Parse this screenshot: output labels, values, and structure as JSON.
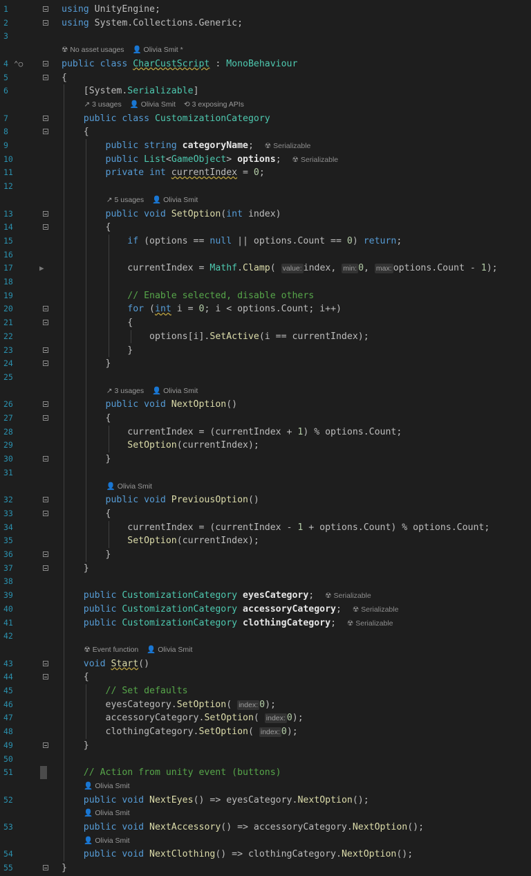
{
  "lines": [
    {
      "n": "1",
      "segs": [
        [
          "kw",
          "using "
        ],
        [
          "var",
          "UnityEngine;"
        ]
      ]
    },
    {
      "n": "2",
      "segs": [
        [
          "kw",
          "using "
        ],
        [
          "var",
          "System.Collections.Generic;"
        ]
      ]
    },
    {
      "n": "3",
      "segs": []
    },
    {
      "n": "",
      "meta": [
        "☢ No asset usages",
        "👤 Olivia Smit *"
      ]
    },
    {
      "n": "4",
      "segs": [
        [
          "kw",
          "public class "
        ],
        [
          "ty squig",
          "CharCustScript"
        ],
        [
          "var",
          " : "
        ],
        [
          "ty",
          "MonoBehaviour"
        ]
      ]
    },
    {
      "n": "5",
      "segs": [
        [
          "var",
          "{"
        ]
      ]
    },
    {
      "n": "6",
      "segs": [
        [
          "var",
          "    [System."
        ],
        [
          "ty",
          "Serializable"
        ],
        [
          "var",
          "]"
        ]
      ]
    },
    {
      "n": "",
      "meta": [
        "↗ 3 usages",
        "👤 Olivia Smit",
        "⟲ 3 exposing APIs"
      ],
      "indent": 4
    },
    {
      "n": "7",
      "segs": [
        [
          "kw",
          "    public class "
        ],
        [
          "ty",
          "CustomizationCategory"
        ]
      ]
    },
    {
      "n": "8",
      "segs": [
        [
          "var",
          "    {"
        ]
      ]
    },
    {
      "n": "9",
      "segs": [
        [
          "kw",
          "        public string "
        ],
        [
          "fld",
          "categoryName"
        ],
        [
          "var",
          ";  "
        ],
        [
          "tag",
          "☢ Serializable"
        ]
      ]
    },
    {
      "n": "10",
      "segs": [
        [
          "kw",
          "        public "
        ],
        [
          "ty",
          "List"
        ],
        [
          "var",
          "<"
        ],
        [
          "ty",
          "GameObject"
        ],
        [
          "var",
          "> "
        ],
        [
          "fld",
          "options"
        ],
        [
          "var",
          ";  "
        ],
        [
          "tag",
          "☢ Serializable"
        ]
      ]
    },
    {
      "n": "11",
      "segs": [
        [
          "kw",
          "        private int "
        ],
        [
          "var squig",
          "currentIndex"
        ],
        [
          "var",
          " = "
        ],
        [
          "num",
          "0"
        ],
        [
          "var",
          ";"
        ]
      ]
    },
    {
      "n": "12",
      "segs": []
    },
    {
      "n": "",
      "meta": [
        "↗ 5 usages",
        "👤 Olivia Smit"
      ],
      "indent": 8
    },
    {
      "n": "13",
      "segs": [
        [
          "kw",
          "        public void "
        ],
        [
          "mth",
          "SetOption"
        ],
        [
          "var",
          "("
        ],
        [
          "kw",
          "int "
        ],
        [
          "var",
          "index)"
        ]
      ]
    },
    {
      "n": "14",
      "segs": [
        [
          "var",
          "        {"
        ]
      ]
    },
    {
      "n": "15",
      "segs": [
        [
          "kw",
          "            if "
        ],
        [
          "var",
          "(options == "
        ],
        [
          "kw",
          "null"
        ],
        [
          "var",
          " || options.Count == "
        ],
        [
          "num",
          "0"
        ],
        [
          "var",
          ") "
        ],
        [
          "kw",
          "return"
        ],
        [
          "var",
          ";"
        ]
      ]
    },
    {
      "n": "16",
      "segs": []
    },
    {
      "n": "17",
      "segs": [
        [
          "var",
          "            currentIndex = "
        ],
        [
          "ty",
          "Mathf"
        ],
        [
          "var",
          "."
        ],
        [
          "mth",
          "Clamp"
        ],
        [
          "var",
          "( "
        ],
        [
          "hint",
          "value:"
        ],
        [
          "var",
          "index, "
        ],
        [
          "hint",
          "min:"
        ],
        [
          "num",
          "0"
        ],
        [
          "var",
          ", "
        ],
        [
          "hint",
          "max:"
        ],
        [
          "var",
          "options.Count - "
        ],
        [
          "num",
          "1"
        ],
        [
          "var",
          ");"
        ]
      ]
    },
    {
      "n": "18",
      "segs": []
    },
    {
      "n": "19",
      "segs": [
        [
          "cm",
          "            // Enable selected, disable others"
        ]
      ]
    },
    {
      "n": "20",
      "segs": [
        [
          "kw",
          "            for "
        ],
        [
          "var",
          "("
        ],
        [
          "kw squig",
          "int"
        ],
        [
          "var",
          " i = "
        ],
        [
          "num",
          "0"
        ],
        [
          "var",
          "; i < options.Count; i++)"
        ]
      ]
    },
    {
      "n": "21",
      "segs": [
        [
          "var",
          "            {"
        ]
      ]
    },
    {
      "n": "22",
      "segs": [
        [
          "var",
          "                options[i]."
        ],
        [
          "mth",
          "SetActive"
        ],
        [
          "var",
          "(i == currentIndex);"
        ]
      ]
    },
    {
      "n": "23",
      "segs": [
        [
          "var",
          "            }"
        ]
      ]
    },
    {
      "n": "24",
      "segs": [
        [
          "var",
          "        }"
        ]
      ]
    },
    {
      "n": "25",
      "segs": []
    },
    {
      "n": "",
      "meta": [
        "↗ 3 usages",
        "👤 Olivia Smit"
      ],
      "indent": 8
    },
    {
      "n": "26",
      "segs": [
        [
          "kw",
          "        public void "
        ],
        [
          "mth",
          "NextOption"
        ],
        [
          "var",
          "()"
        ]
      ]
    },
    {
      "n": "27",
      "segs": [
        [
          "var",
          "        {"
        ]
      ]
    },
    {
      "n": "28",
      "segs": [
        [
          "var",
          "            currentIndex = (currentIndex + "
        ],
        [
          "num",
          "1"
        ],
        [
          "var",
          ") % options.Count;"
        ]
      ]
    },
    {
      "n": "29",
      "segs": [
        [
          "mth",
          "            SetOption"
        ],
        [
          "var",
          "(currentIndex);"
        ]
      ]
    },
    {
      "n": "30",
      "segs": [
        [
          "var",
          "        }"
        ]
      ]
    },
    {
      "n": "31",
      "segs": []
    },
    {
      "n": "",
      "meta": [
        "👤 Olivia Smit"
      ],
      "indent": 8
    },
    {
      "n": "32",
      "segs": [
        [
          "kw",
          "        public void "
        ],
        [
          "mth",
          "PreviousOption"
        ],
        [
          "var",
          "()"
        ]
      ]
    },
    {
      "n": "33",
      "segs": [
        [
          "var",
          "        {"
        ]
      ]
    },
    {
      "n": "34",
      "segs": [
        [
          "var",
          "            currentIndex = (currentIndex - "
        ],
        [
          "num",
          "1"
        ],
        [
          "var",
          " + options.Count) % options.Count;"
        ]
      ]
    },
    {
      "n": "35",
      "segs": [
        [
          "mth",
          "            SetOption"
        ],
        [
          "var",
          "(currentIndex);"
        ]
      ]
    },
    {
      "n": "36",
      "segs": [
        [
          "var",
          "        }"
        ]
      ]
    },
    {
      "n": "37",
      "segs": [
        [
          "var",
          "    }"
        ]
      ]
    },
    {
      "n": "38",
      "segs": []
    },
    {
      "n": "39",
      "segs": [
        [
          "kw",
          "    public "
        ],
        [
          "ty",
          "CustomizationCategory "
        ],
        [
          "fld",
          "eyesCategory"
        ],
        [
          "var",
          ";  "
        ],
        [
          "tag",
          "☢ Serializable"
        ]
      ]
    },
    {
      "n": "40",
      "segs": [
        [
          "kw",
          "    public "
        ],
        [
          "ty",
          "CustomizationCategory "
        ],
        [
          "fld",
          "accessoryCategory"
        ],
        [
          "var",
          ";  "
        ],
        [
          "tag",
          "☢ Serializable"
        ]
      ]
    },
    {
      "n": "41",
      "segs": [
        [
          "kw",
          "    public "
        ],
        [
          "ty",
          "CustomizationCategory "
        ],
        [
          "fld",
          "clothingCategory"
        ],
        [
          "var",
          ";  "
        ],
        [
          "tag",
          "☢ Serializable"
        ]
      ]
    },
    {
      "n": "42",
      "segs": []
    },
    {
      "n": "",
      "meta": [
        "☢ Event function",
        "👤 Olivia Smit"
      ],
      "indent": 4
    },
    {
      "n": "43",
      "segs": [
        [
          "kw",
          "    void "
        ],
        [
          "mth squig",
          "Start"
        ],
        [
          "var",
          "()"
        ]
      ]
    },
    {
      "n": "44",
      "segs": [
        [
          "var",
          "    {"
        ]
      ]
    },
    {
      "n": "45",
      "segs": [
        [
          "cm",
          "        // Set defaults"
        ]
      ]
    },
    {
      "n": "46",
      "segs": [
        [
          "var",
          "        eyesCategory."
        ],
        [
          "mth",
          "SetOption"
        ],
        [
          "var",
          "( "
        ],
        [
          "hint",
          "index:"
        ],
        [
          "num",
          "0"
        ],
        [
          "var",
          ");"
        ]
      ]
    },
    {
      "n": "47",
      "segs": [
        [
          "var",
          "        accessoryCategory."
        ],
        [
          "mth",
          "SetOption"
        ],
        [
          "var",
          "( "
        ],
        [
          "hint",
          "index:"
        ],
        [
          "num",
          "0"
        ],
        [
          "var",
          ");"
        ]
      ]
    },
    {
      "n": "48",
      "segs": [
        [
          "var",
          "        clothingCategory."
        ],
        [
          "mth",
          "SetOption"
        ],
        [
          "var",
          "( "
        ],
        [
          "hint",
          "index:"
        ],
        [
          "num",
          "0"
        ],
        [
          "var",
          ");"
        ]
      ]
    },
    {
      "n": "49",
      "segs": [
        [
          "var",
          "    }"
        ]
      ]
    },
    {
      "n": "50",
      "segs": []
    },
    {
      "n": "51",
      "segs": [
        [
          "cm",
          "    // Action from unity event (buttons)"
        ]
      ]
    },
    {
      "n": "",
      "meta": [
        "👤 Olivia Smit"
      ],
      "indent": 4
    },
    {
      "n": "52",
      "segs": [
        [
          "kw",
          "    public void "
        ],
        [
          "mth",
          "NextEyes"
        ],
        [
          "var",
          "() => eyesCategory."
        ],
        [
          "mth",
          "NextOption"
        ],
        [
          "var",
          "();"
        ]
      ]
    },
    {
      "n": "",
      "meta": [
        "👤 Olivia Smit"
      ],
      "indent": 4
    },
    {
      "n": "53",
      "segs": [
        [
          "kw",
          "    public void "
        ],
        [
          "mth",
          "NextAccessory"
        ],
        [
          "var",
          "() => accessoryCategory."
        ],
        [
          "mth",
          "NextOption"
        ],
        [
          "var",
          "();"
        ]
      ]
    },
    {
      "n": "",
      "meta": [
        "👤 Olivia Smit"
      ],
      "indent": 4
    },
    {
      "n": "54",
      "segs": [
        [
          "kw",
          "    public void "
        ],
        [
          "mth",
          "NextClothing"
        ],
        [
          "var",
          "() => clothingCategory."
        ],
        [
          "mth",
          "NextOption"
        ],
        [
          "var",
          "();"
        ]
      ]
    },
    {
      "n": "55",
      "segs": [
        [
          "var",
          "}"
        ]
      ]
    }
  ],
  "colors": {
    "background": "#1e1e1e",
    "keyword": "#569cd6",
    "type": "#4ec9b0",
    "method": "#dcdcaa",
    "comment": "#57a64a",
    "number": "#b5cea8",
    "line_number": "#2b91af"
  },
  "icons": {
    "class_marker": "override-indicator-icon",
    "fold": "fold-box-icon",
    "breakpoint_arrow": "execution-arrow-icon"
  }
}
